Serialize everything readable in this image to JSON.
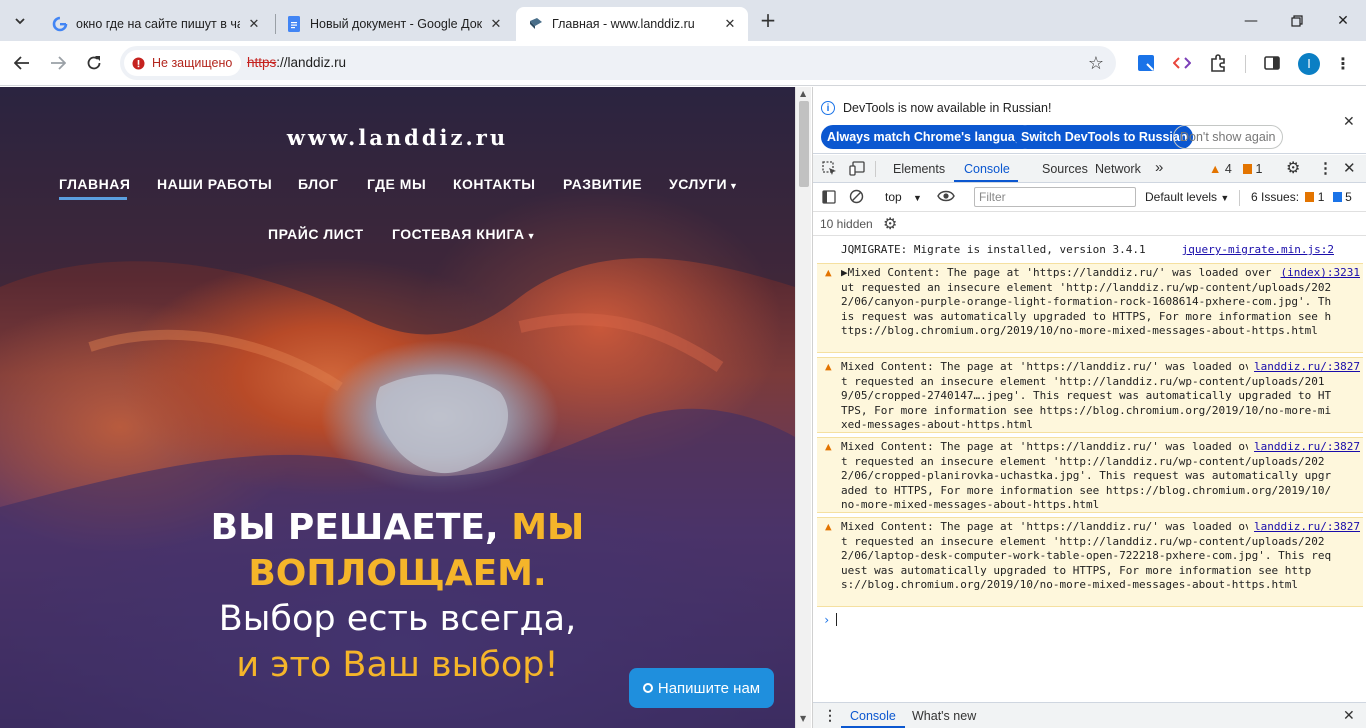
{
  "browser": {
    "tabs": [
      {
        "title": "окно где на сайте пишут в чат",
        "favicon": "google-icon",
        "active": false
      },
      {
        "title": "Новый документ - Google Док",
        "favicon": "docs-icon",
        "active": false
      },
      {
        "title": "Главная - www.landdiz.ru",
        "favicon": "site-icon",
        "active": true
      }
    ],
    "security_label": "Не защищено",
    "url_protocol": "https",
    "url_rest": "://landdiz.ru",
    "profile_initial": "I"
  },
  "site": {
    "title": "www.landdiz.ru",
    "nav": [
      "ГЛАВНАЯ",
      "НАШИ РАБОТЫ",
      "БЛОГ",
      "ГДЕ МЫ",
      "КОНТАКТЫ",
      "РАЗВИТИЕ",
      "УСЛУГИ",
      "ПРАЙС ЛИСТ",
      "ГОСТЕВАЯ КНИГА"
    ],
    "hero_white": "ВЫ РЕШАЕТЕ,",
    "hero_yellow1": "МЫ",
    "hero_yellow2": "ВОПЛОЩАЕМ.",
    "hero_sub1": "Выбор есть всегда,",
    "hero_sub2": "и это Ваш выбор!",
    "chat_button": "Напишите нам"
  },
  "devtools": {
    "info_text": "DevTools is now available in Russian!",
    "btn_match": "Always match Chrome's language",
    "btn_switch": "Switch DevTools to Russian",
    "btn_dont_show": "Don't show again",
    "tabs": [
      "Elements",
      "Console",
      "Sources",
      "Network"
    ],
    "warn_count": "4",
    "issue_count": "1",
    "context": "top",
    "filter_placeholder": "Filter",
    "levels": "Default levels",
    "issues_label": "6 Issues:",
    "issues_error": "1",
    "issues_info": "5",
    "hidden": "10 hidden",
    "log_line": "JQMIGRATE: Migrate is installed, version 3.4.1",
    "log_src": "jquery-migrate.min.js:2",
    "messages": [
      {
        "text": "▶Mixed Content: The page at 'https://landdiz.ru/' was loaded over HTTPS, but requested an insecure element 'http://landdiz.ru/wp-content/uploads/2022/06/canyon-purple-orange-light-formation-rock-1608614-pxhere-com.jpg'. This request was automatically upgraded to HTTPS, For more information see https://blog.chromium.org/2019/10/no-more-mixed-messages-about-https.html",
        "src": "(index):3231"
      },
      {
        "text": "Mixed Content: The page at 'https://landdiz.ru/' was loaded over HTTPS, but requested an insecure element 'http://landdiz.ru/wp-content/uploads/2019/05/cropped-2740147….jpeg'. This request was automatically upgraded to HTTPS, For more information see https://blog.chromium.org/2019/10/no-more-mixed-messages-about-https.html",
        "src": "landdiz.ru/:3827"
      },
      {
        "text": "Mixed Content: The page at 'https://landdiz.ru/' was loaded over HTTPS, but requested an insecure element 'http://landdiz.ru/wp-content/uploads/2022/06/cropped-planirovka-uchastka.jpg'. This request was automatically upgraded to HTTPS, For more information see https://blog.chromium.org/2019/10/no-more-mixed-messages-about-https.html",
        "src": "landdiz.ru/:3827"
      },
      {
        "text": "Mixed Content: The page at 'https://landdiz.ru/' was loaded over HTTPS, but requested an insecure element 'http://landdiz.ru/wp-content/uploads/2022/06/laptop-desk-computer-work-table-open-722218-pxhere-com.jpg'. This request was automatically upgraded to HTTPS, For more information see https://blog.chromium.org/2019/10/no-more-mixed-messages-about-https.html",
        "src": "landdiz.ru/:3827"
      }
    ],
    "drawer_tabs": [
      "Console",
      "What's new"
    ]
  },
  "colors": {
    "accent_yellow": "#f5b52a",
    "devtools_blue": "#0b57d0",
    "chat_blue": "#1f8fdd"
  }
}
